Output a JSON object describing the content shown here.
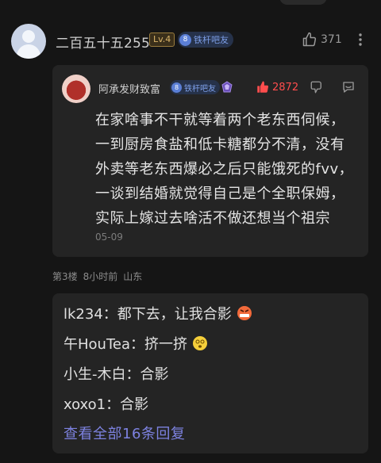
{
  "comment": {
    "username": "二百五十五255",
    "level": "Lv.4",
    "bar_badge_num": "8",
    "bar_badge_text": "铁杆吧友",
    "like_count": "371"
  },
  "quote": {
    "username": "阿承发财致富",
    "bar_badge_num": "8",
    "bar_badge_text": "铁杆吧友",
    "like_count": "2872",
    "lines": [
      "在家啥事不干就等着两个老东西伺候，",
      "一到厨房食盐和低卡糖都分不清，没有",
      "外卖等老东西爆必之后只能饿死的fvv，",
      "一谈到结婚就觉得自己是个全职保姆，",
      "实际上嫁过去啥活不做还想当个祖宗"
    ],
    "date": "05-09"
  },
  "meta": {
    "floor": "第3楼",
    "time": "8小时前",
    "location": "山东"
  },
  "replies": [
    {
      "user": "lk234：",
      "text": "都下去，让我合影",
      "emoji": "angry-emoji"
    },
    {
      "user": "午HouTea：",
      "text": "挤一挤",
      "emoji": "dizzy-emoji"
    },
    {
      "user": "小生-木白：",
      "text": "合影",
      "emoji": ""
    },
    {
      "user": "xoxo1：",
      "text": "合影",
      "emoji": ""
    }
  ],
  "view_all": "查看全部16条回复",
  "colors": {
    "accent_link": "#7d82e0",
    "like_red": "#ff4d4d",
    "badge_blue": "#5b7fd6"
  }
}
